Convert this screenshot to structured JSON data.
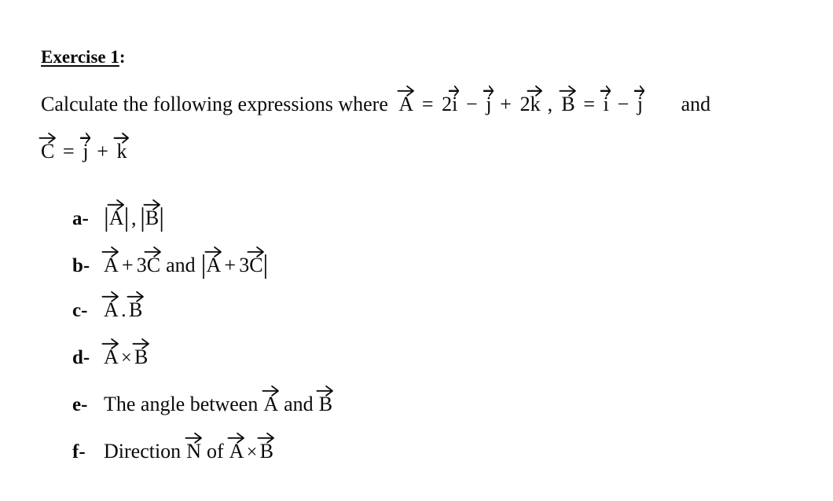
{
  "document": {
    "background_color": "#ffffff",
    "text_color": "#0a0a0a"
  },
  "heading": {
    "underlined_text": "Exercise 1",
    "trailing": ":"
  },
  "intro": {
    "lead_text": "Calculate the following expressions where",
    "vector_a_label": "A",
    "eq": "=",
    "a_term1_coeff": "2",
    "a_term1_unit": "i",
    "a_op1": "−",
    "a_term2_unit": "j",
    "a_op2": "+",
    "a_term3_coeff": "2",
    "a_term3_unit": "k",
    "comma": ",",
    "vector_b_label": "B",
    "b_term1_unit": "i",
    "b_op1": "−",
    "b_term2_unit": "j",
    "and_word": "and",
    "vector_c_label": "C",
    "c_term1_unit": "j",
    "c_op1": "+",
    "c_term2_unit": "k"
  },
  "list": {
    "items": [
      {
        "marker": "a-",
        "kind": "magnitudes",
        "bar": "|",
        "v1": "A",
        "sep": ",",
        "v2": "B"
      },
      {
        "marker": "b-",
        "kind": "sum_and_magnitude",
        "v1": "A",
        "op": "+",
        "coeff": "3",
        "v2": "C",
        "conj": "and",
        "bar": "|"
      },
      {
        "marker": "c-",
        "kind": "dot_product",
        "v1": "A",
        "op": ".",
        "v2": "B"
      },
      {
        "marker": "d-",
        "kind": "cross_product",
        "v1": "A",
        "op": "×",
        "v2": "B"
      },
      {
        "marker": "e-",
        "kind": "angle",
        "text_before": "The angle between",
        "v1": "A",
        "text_middle": "and",
        "v2": "B"
      },
      {
        "marker": "f-",
        "kind": "direction",
        "text_before": "Direction",
        "vn": "N",
        "text_middle": "of",
        "v1": "A",
        "op": "×",
        "v2": "B"
      }
    ]
  }
}
